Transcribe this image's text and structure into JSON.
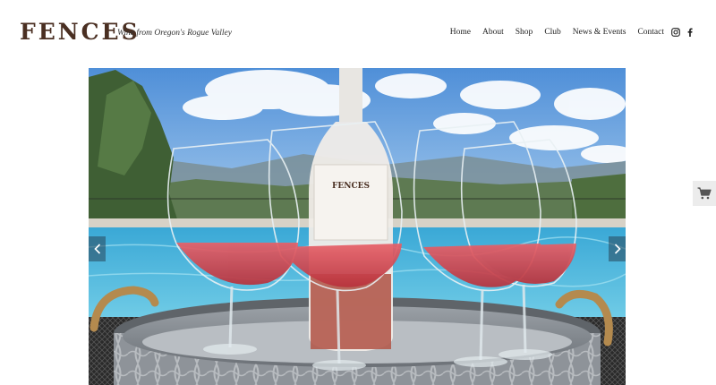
{
  "brand": {
    "logo_text": "FENCES",
    "tagline": "Wine from Oregon's Rogue Valley"
  },
  "nav": {
    "items": [
      "Home",
      "About",
      "Shop",
      "Club",
      "News & Events",
      "Contact"
    ]
  },
  "social": {
    "icons": [
      "instagram-icon",
      "facebook-icon"
    ]
  },
  "hero": {
    "bottle_label": "FENCES"
  },
  "controls": {
    "prev_icon": "chevron-left-icon",
    "next_icon": "chevron-right-icon",
    "cart_icon": "shopping-cart-icon"
  },
  "colors": {
    "logo": "#4a2f22",
    "wine": "#d84a52",
    "pool": "#4fb3d4",
    "sky": "#6ea9e0",
    "accent_arrow": "#28465a"
  }
}
